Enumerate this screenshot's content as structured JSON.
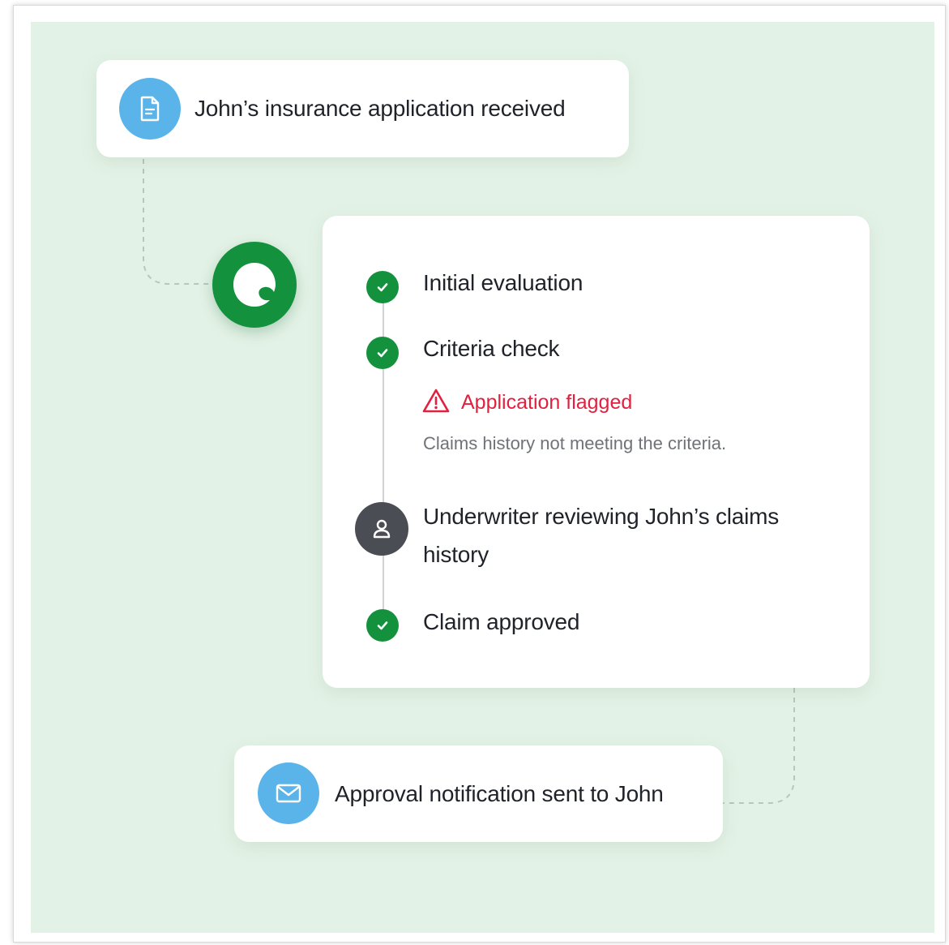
{
  "colors": {
    "background": "#e3f2e6",
    "card": "#ffffff",
    "accent_green": "#14913c",
    "info_blue": "#5ab4ea",
    "reviewer_gray": "#4b4d55",
    "alert_red": "#e0213f",
    "connector": "#b9c6bb"
  },
  "start_card": {
    "icon": "document-icon",
    "label": "John’s insurance application received"
  },
  "brand": {
    "icon": "brand-logo"
  },
  "steps": [
    {
      "icon": "check-circle-icon",
      "label": "Initial evaluation",
      "status": "done"
    },
    {
      "icon": "check-circle-icon",
      "label": "Criteria check",
      "status": "done"
    },
    {
      "icon": "user-icon",
      "label": "Underwriter reviewing John’s claims history",
      "status": "in-review"
    },
    {
      "icon": "check-circle-icon",
      "label": "Claim approved",
      "status": "done"
    }
  ],
  "flag": {
    "icon": "warning-triangle-icon",
    "label": "Application flagged",
    "note": "Claims history not meeting the criteria."
  },
  "end_card": {
    "icon": "envelope-icon",
    "label": "Approval notification sent to John"
  }
}
